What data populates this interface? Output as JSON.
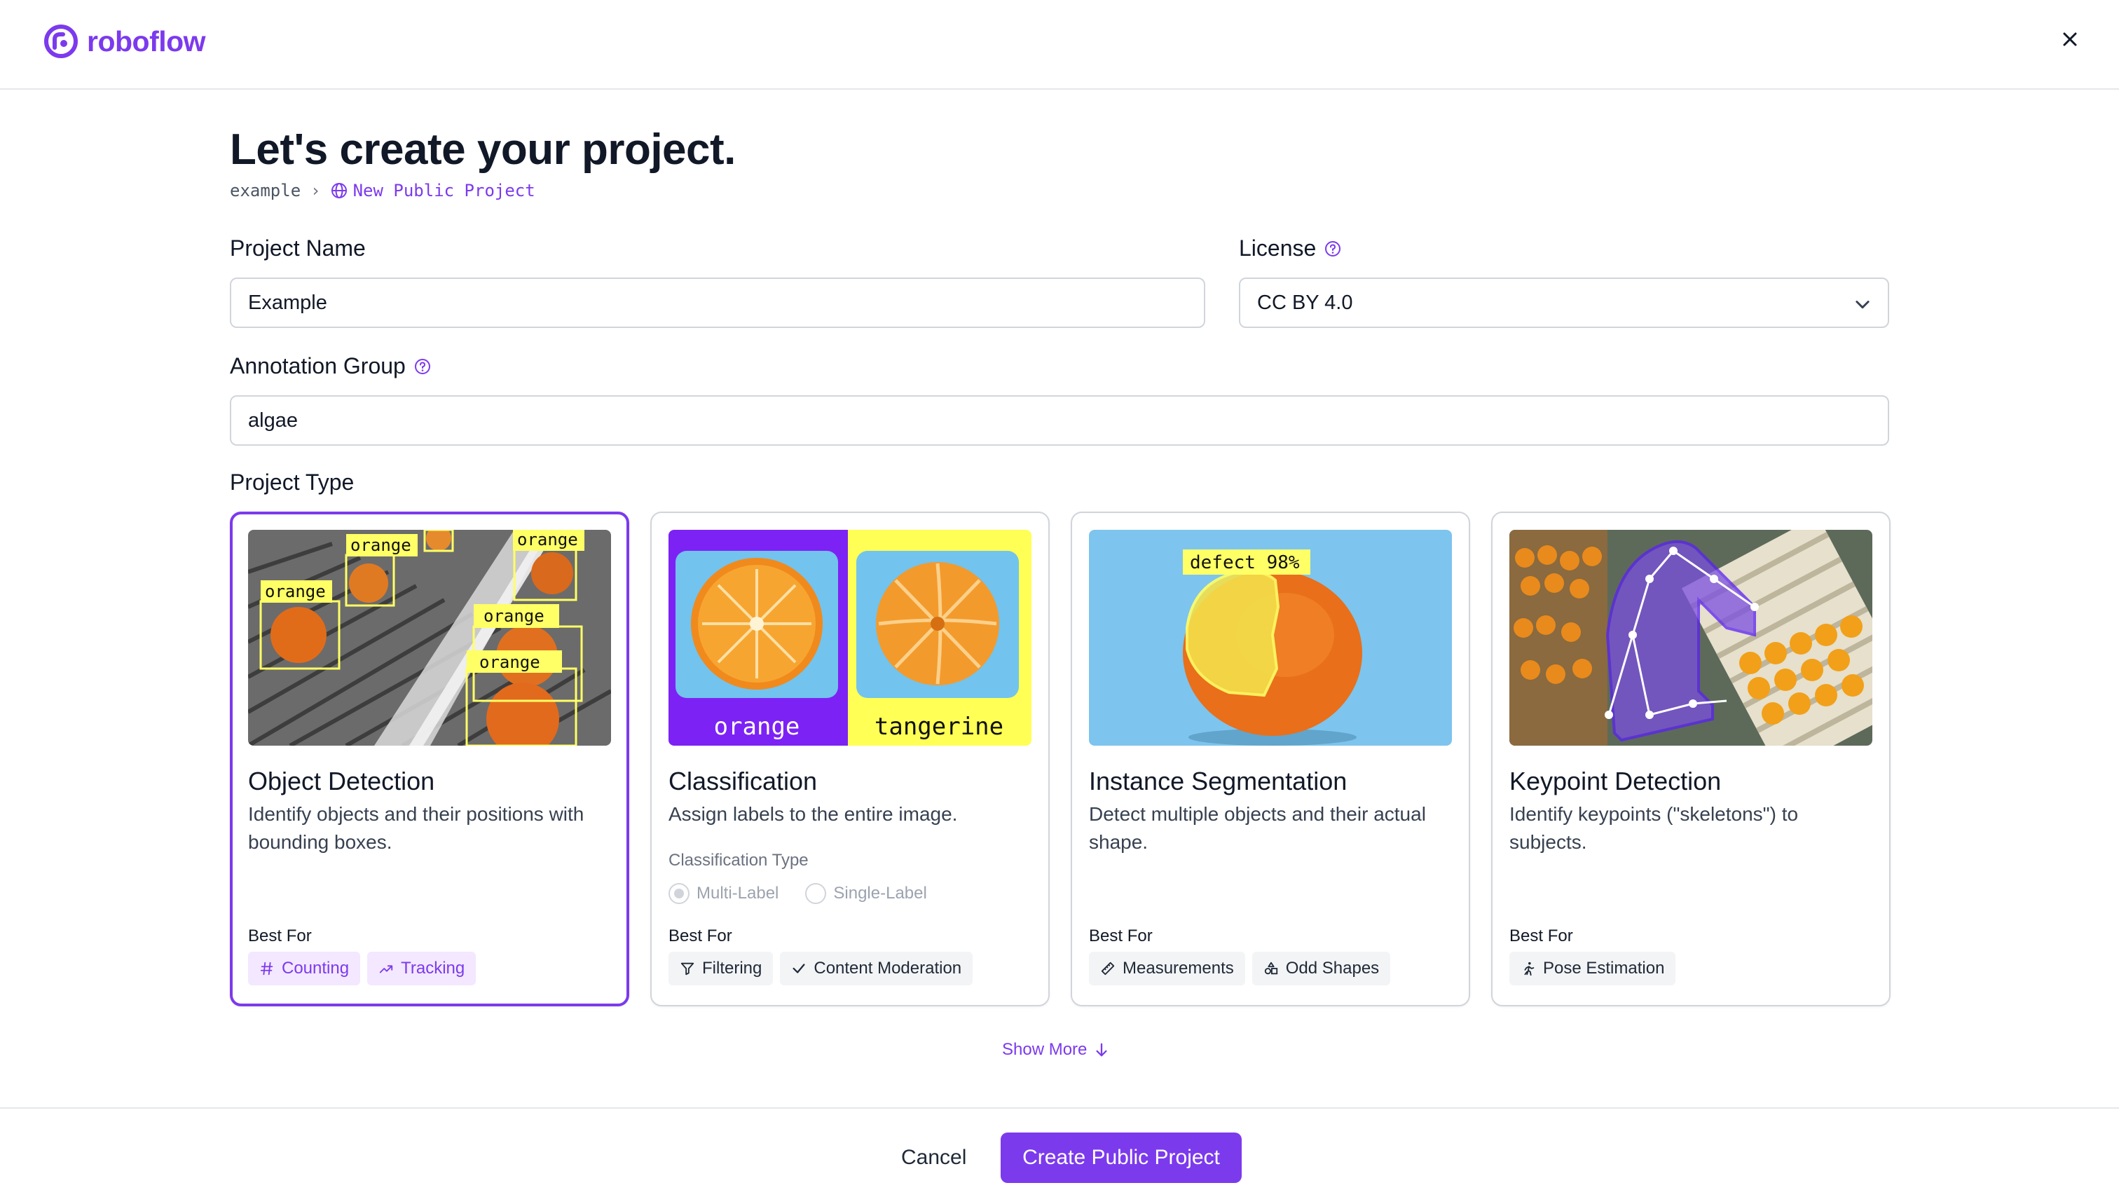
{
  "header": {
    "brand": "roboflow",
    "brand_color": "#7c3aed"
  },
  "page": {
    "title": "Let's create your project.",
    "breadcrumb": {
      "workspace": "example",
      "separator": "›",
      "current": "New Public Project",
      "icon": "globe-icon"
    }
  },
  "form": {
    "project_name": {
      "label": "Project Name",
      "value": "Example"
    },
    "license": {
      "label": "License",
      "value": "CC BY 4.0",
      "help_icon": "question-circle-icon"
    },
    "annotation_group": {
      "label": "Annotation Group",
      "value": "algae",
      "help_icon": "question-circle-icon"
    },
    "project_type_label": "Project Type"
  },
  "project_types": [
    {
      "title": "Object Detection",
      "description": "Identify objects and their positions with bounding boxes.",
      "best_for_label": "Best For",
      "selected": true,
      "image_labels": [
        "orange",
        "orange",
        "orange",
        "orange",
        "orange"
      ],
      "chips": [
        {
          "label": "Counting",
          "icon": "hash-icon"
        },
        {
          "label": "Tracking",
          "icon": "tracking-icon"
        }
      ]
    },
    {
      "title": "Classification",
      "description": "Assign labels to the entire image.",
      "best_for_label": "Best For",
      "selected": false,
      "image_labels": [
        "orange",
        "tangerine"
      ],
      "classification_type": {
        "label": "Classification Type",
        "options": [
          "Multi-Label",
          "Single-Label"
        ],
        "selected": "Multi-Label"
      },
      "chips": [
        {
          "label": "Filtering",
          "icon": "filter-icon"
        },
        {
          "label": "Content Moderation",
          "icon": "check-icon"
        }
      ]
    },
    {
      "title": "Instance Segmentation",
      "description": "Detect multiple objects and their actual shape.",
      "best_for_label": "Best For",
      "selected": false,
      "image_labels": [
        "defect 98%"
      ],
      "chips": [
        {
          "label": "Measurements",
          "icon": "ruler-icon"
        },
        {
          "label": "Odd Shapes",
          "icon": "shapes-icon"
        }
      ]
    },
    {
      "title": "Keypoint Detection",
      "description": "Identify keypoints (\"skeletons\") to subjects.",
      "best_for_label": "Best For",
      "selected": false,
      "chips": [
        {
          "label": "Pose Estimation",
          "icon": "person-running-icon"
        }
      ]
    }
  ],
  "show_more": "Show More",
  "footer": {
    "cancel": "Cancel",
    "create": "Create Public Project"
  },
  "colors": {
    "accent": "#7c3aed",
    "chip_purple_bg": "#f3e8ff",
    "border": "#d1d5db",
    "label_yellow": "#ffff66",
    "seg_blue": "#7dc4ee"
  }
}
